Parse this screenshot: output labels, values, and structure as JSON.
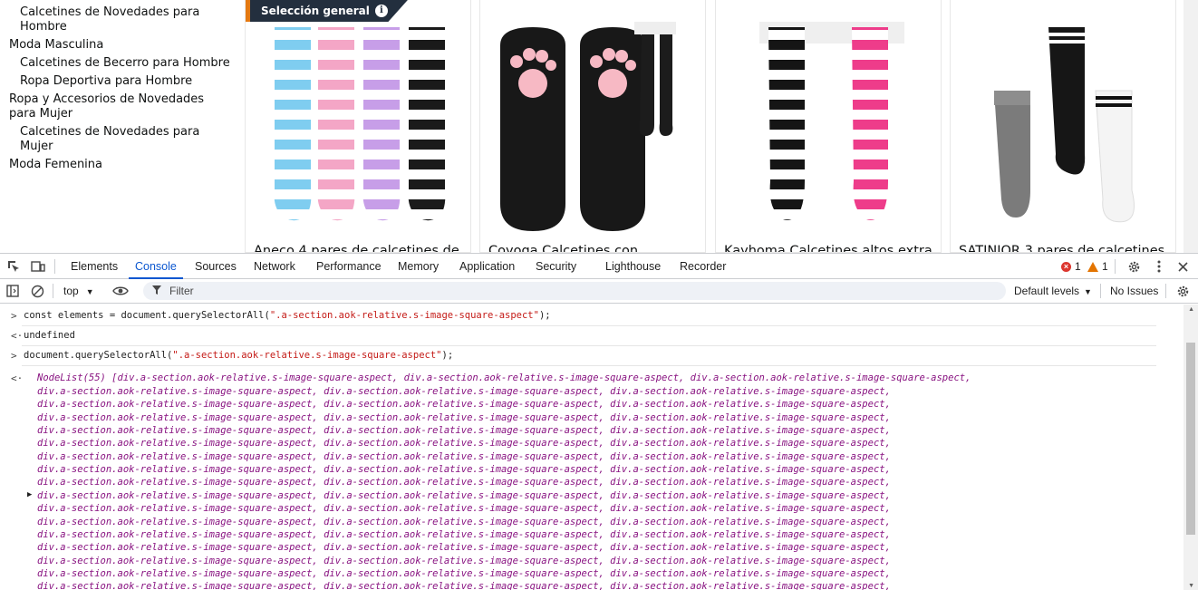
{
  "sidebar": {
    "categories": [
      {
        "label": "Calcetines de Novedades para Hombre",
        "level": 2
      },
      {
        "label": "Moda Masculina",
        "level": 1
      },
      {
        "label": "Calcetines de Becerro para Hombre",
        "level": 2
      },
      {
        "label": "Ropa Deportiva para Hombre",
        "level": 2
      },
      {
        "label": "Ropa y Accesorios de Novedades para Mujer",
        "level": 1
      },
      {
        "label": "Calcetines de Novedades para Mujer",
        "level": 2
      },
      {
        "label": "Moda Femenina",
        "level": 1
      }
    ]
  },
  "badge": {
    "label": "Selección general",
    "icon": "info-icon"
  },
  "products": [
    {
      "title": "Aneco 4 pares de calcetines de",
      "image": "striped-thigh-high-socks"
    },
    {
      "title": "Coyoga Calcetines con",
      "image": "cat-paw-socks"
    },
    {
      "title": "Kayhoma Calcetines altos extra",
      "image": "striped-over-knee-socks"
    },
    {
      "title": "SATINIOR 3 pares de calcetines",
      "image": "three-pairs-socks"
    }
  ],
  "devtools": {
    "tabs": [
      "Elements",
      "Console",
      "Sources",
      "Network",
      "Performance",
      "Memory",
      "Application",
      "Security",
      "Lighthouse",
      "Recorder"
    ],
    "active_tab": "Console",
    "errors": "1",
    "warnings": "1",
    "context": "top",
    "filter_placeholder": "Filter",
    "levels": "Default levels",
    "issues": "No Issues",
    "colors": {
      "accent": "#0b57d0",
      "error": "#dc362e",
      "warning": "#e37400"
    }
  },
  "console": {
    "entries": [
      {
        "prefix": ">",
        "code_pre": "const elements = document.querySelectorAll(",
        "code_str": "\".a-section.aok-relative.s-image-square-aspect\"",
        "code_post": ");"
      },
      {
        "prefix": "<·",
        "code_pre": "undefined",
        "code_str": "",
        "code_post": ""
      },
      {
        "prefix": ">",
        "code_pre": "document.querySelectorAll(",
        "code_str": "\".a-section.aok-relative.s-image-square-aspect\"",
        "code_post": ");"
      }
    ],
    "result_prefix": "<·",
    "nodelist_head": "NodeList(55) [div.a-section.aok-relative.s-image-square-aspect, div.a-section.aok-relative.s-image-square-aspect, div.a-section.aok-relative.s-image-square-aspect,",
    "nodelist_item": "div.a-section.aok-relative.s-image-square-aspect",
    "nodelist_rows": 16,
    "expander": "▶"
  }
}
